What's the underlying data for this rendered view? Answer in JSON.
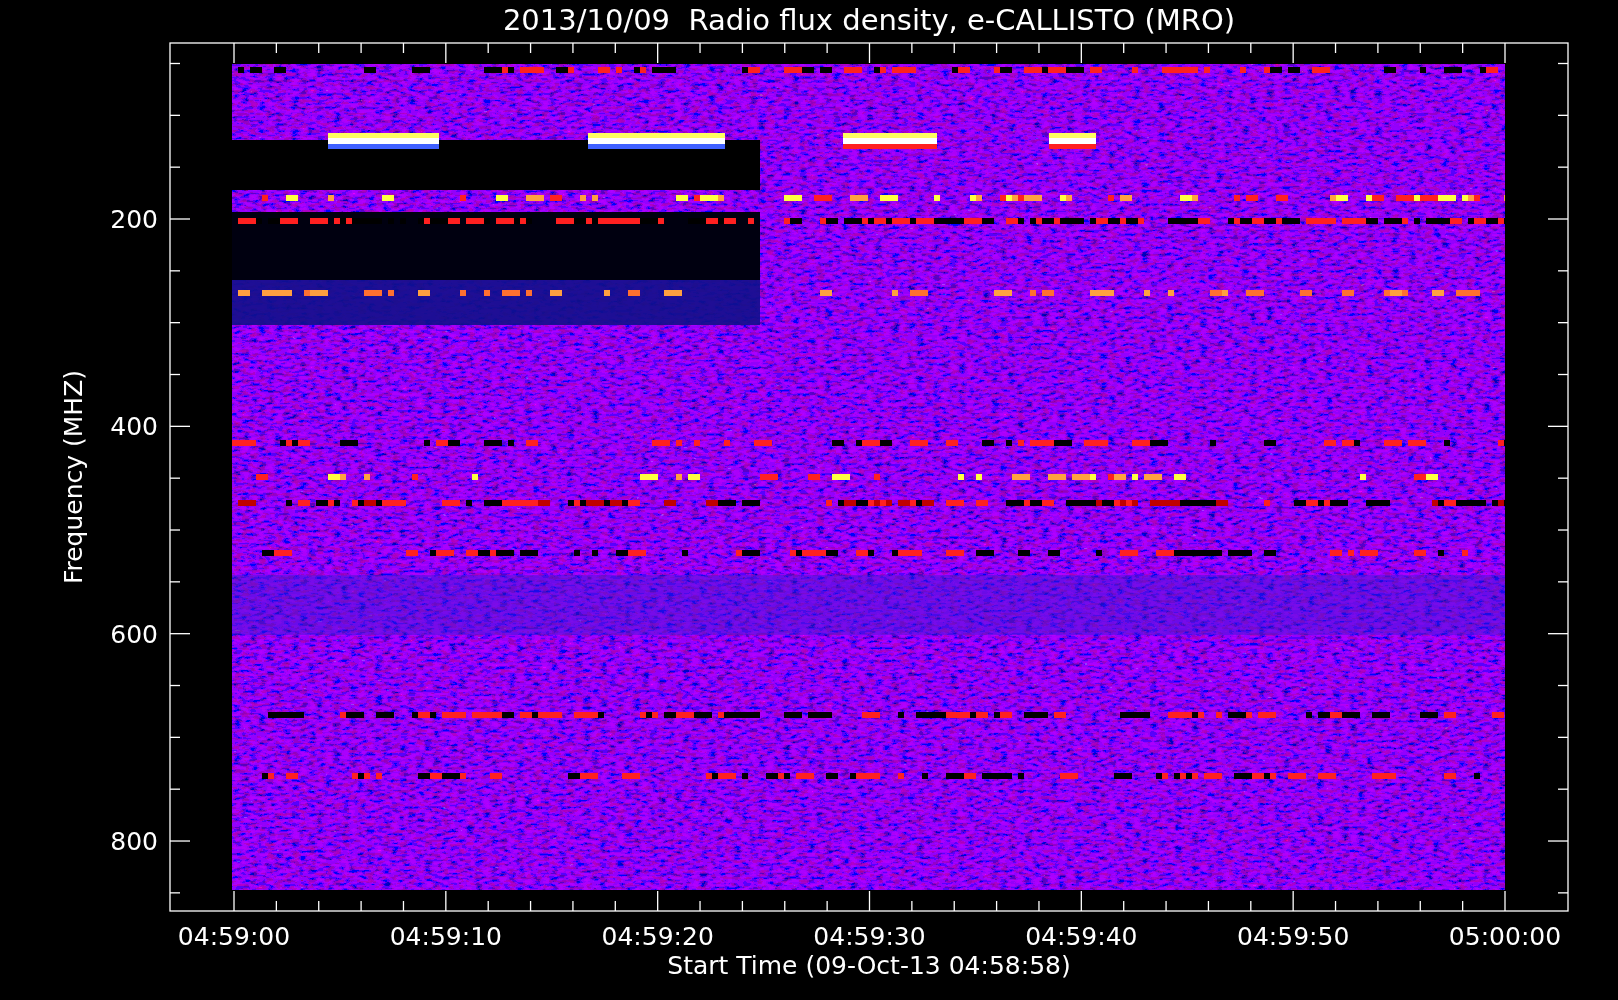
{
  "title": "2013/10/09  Radio flux density, e-CALLISTO (MRO)",
  "y_axis": {
    "label": "Frequency (MHZ)",
    "ticks": [
      "200",
      "400",
      "600",
      "800"
    ]
  },
  "x_axis": {
    "label": "Start Time (09-Oct-13 04:58:58)",
    "ticks": [
      "04:59:00",
      "04:59:10",
      "04:59:20",
      "04:59:30",
      "04:59:40",
      "04:59:50",
      "05:00:00"
    ]
  }
}
